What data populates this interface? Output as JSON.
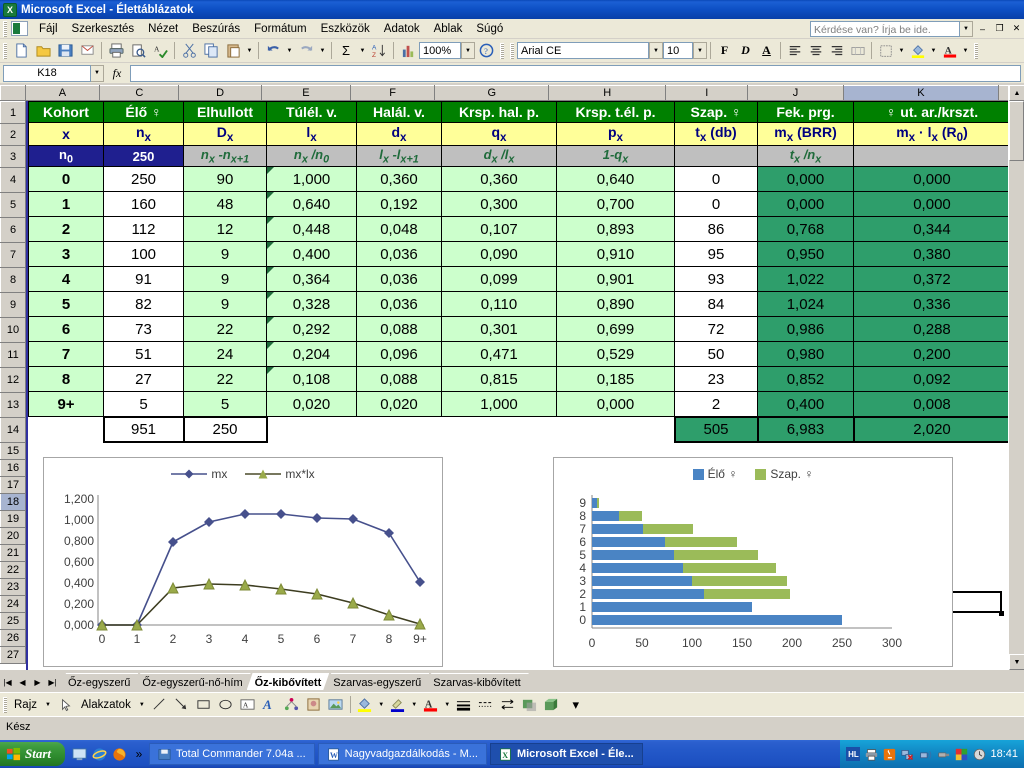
{
  "window": {
    "title": "Microsoft Excel - Élettáblázatok",
    "logo_icon": "excel-icon",
    "minimize": "–",
    "restore": "❐",
    "close": "✕"
  },
  "menu": {
    "items": [
      "Fájl",
      "Szerkesztés",
      "Nézet",
      "Beszúrás",
      "Formátum",
      "Eszközök",
      "Adatok",
      "Ablak",
      "Súgó"
    ],
    "help_placeholder": "Kérdése van? Írja be ide."
  },
  "toolbar": {
    "zoom": "100%",
    "font_name": "Arial CE",
    "font_size": "10",
    "bold": "F",
    "italic": "D",
    "underline": "A"
  },
  "formula_bar": {
    "name_box": "K18",
    "fx": "fx",
    "value": ""
  },
  "grid": {
    "columns": [
      "A",
      "C",
      "D",
      "E",
      "F",
      "G",
      "H",
      "I",
      "J",
      "K"
    ],
    "selected_column": "K",
    "selected_row": "18",
    "row_numbers": [
      "1",
      "2",
      "3",
      "4",
      "5",
      "6",
      "7",
      "8",
      "9",
      "10",
      "11",
      "12",
      "13",
      "14",
      "15",
      "16",
      "17",
      "18",
      "19",
      "20",
      "21",
      "22",
      "23",
      "24",
      "25",
      "26",
      "27"
    ],
    "header_row1": [
      "Kohort",
      "Élő ♀",
      "Elhullott",
      "Túlél. v.",
      "Halál. v.",
      "Krsp. hal. p.",
      "Krsp. t.él. p.",
      "Szap. ♀",
      "Fek. prg.",
      "♀ ut. ar./krszt."
    ],
    "header_row2": [
      "x",
      "n_x",
      "D_x",
      "l_x",
      "d_x",
      "q_x",
      "p_x",
      "t_x (db)",
      "m_x (BRR)",
      "m_x · l_x (R_0)"
    ],
    "header_row3": [
      "n_0",
      "250",
      "n_x -n_x+1",
      "n_x /n_0",
      "l_x -l_x+1",
      "d_x /l_x",
      "1-q_x",
      "",
      "t_x /n_x",
      ""
    ],
    "data_rows": [
      {
        "row": "4",
        "kohort": "0",
        "elo": "250",
        "elhullott": "90",
        "tulel": "1,000",
        "halal": "0,360",
        "q": "0,360",
        "p": "0,640",
        "szap": "0",
        "fek": "0,000",
        "ut": "0,000"
      },
      {
        "row": "5",
        "kohort": "1",
        "elo": "160",
        "elhullott": "48",
        "tulel": "0,640",
        "halal": "0,192",
        "q": "0,300",
        "p": "0,700",
        "szap": "0",
        "fek": "0,000",
        "ut": "0,000"
      },
      {
        "row": "6",
        "kohort": "2",
        "elo": "112",
        "elhullott": "12",
        "tulel": "0,448",
        "halal": "0,048",
        "q": "0,107",
        "p": "0,893",
        "szap": "86",
        "fek": "0,768",
        "ut": "0,344"
      },
      {
        "row": "7",
        "kohort": "3",
        "elo": "100",
        "elhullott": "9",
        "tulel": "0,400",
        "halal": "0,036",
        "q": "0,090",
        "p": "0,910",
        "szap": "95",
        "fek": "0,950",
        "ut": "0,380"
      },
      {
        "row": "8",
        "kohort": "4",
        "elo": "91",
        "elhullott": "9",
        "tulel": "0,364",
        "halal": "0,036",
        "q": "0,099",
        "p": "0,901",
        "szap": "93",
        "fek": "1,022",
        "ut": "0,372"
      },
      {
        "row": "9",
        "kohort": "5",
        "elo": "82",
        "elhullott": "9",
        "tulel": "0,328",
        "halal": "0,036",
        "q": "0,110",
        "p": "0,890",
        "szap": "84",
        "fek": "1,024",
        "ut": "0,336"
      },
      {
        "row": "10",
        "kohort": "6",
        "elo": "73",
        "elhullott": "22",
        "tulel": "0,292",
        "halal": "0,088",
        "q": "0,301",
        "p": "0,699",
        "szap": "72",
        "fek": "0,986",
        "ut": "0,288"
      },
      {
        "row": "11",
        "kohort": "7",
        "elo": "51",
        "elhullott": "24",
        "tulel": "0,204",
        "halal": "0,096",
        "q": "0,471",
        "p": "0,529",
        "szap": "50",
        "fek": "0,980",
        "ut": "0,200"
      },
      {
        "row": "12",
        "kohort": "8",
        "elo": "27",
        "elhullott": "22",
        "tulel": "0,108",
        "halal": "0,088",
        "q": "0,815",
        "p": "0,185",
        "szap": "23",
        "fek": "0,852",
        "ut": "0,092"
      },
      {
        "row": "13",
        "kohort": "9+",
        "elo": "5",
        "elhullott": "5",
        "tulel": "0,020",
        "halal": "0,020",
        "q": "1,000",
        "p": "0,000",
        "szap": "2",
        "fek": "0,400",
        "ut": "0,008"
      }
    ],
    "sum_row": {
      "row": "14",
      "elo": "951",
      "elhullott": "250",
      "szap": "505",
      "fek": "6,983",
      "ut": "2,020"
    }
  },
  "chart_data": [
    {
      "type": "line",
      "title": "",
      "categories": [
        "0",
        "1",
        "2",
        "3",
        "4",
        "5",
        "6",
        "7",
        "8",
        "9+"
      ],
      "series": [
        {
          "name": "mx",
          "values": [
            0.0,
            0.0,
            0.768,
            0.95,
            1.022,
            1.024,
            0.986,
            0.98,
            0.852,
            0.4
          ],
          "color": "#46508c"
        },
        {
          "name": "mx*lx",
          "values": [
            0.0,
            0.0,
            0.344,
            0.38,
            0.372,
            0.336,
            0.288,
            0.2,
            0.092,
            0.008
          ],
          "color": "#9aaa4a"
        }
      ],
      "ytick_labels": [
        "0,000",
        "0,200",
        "0,400",
        "0,600",
        "0,800",
        "1,000",
        "1,200"
      ],
      "ylim": [
        0,
        1.2
      ],
      "xlabel": "",
      "ylabel": "",
      "legend_position": "top",
      "grid": false
    },
    {
      "type": "bar",
      "orientation": "horizontal",
      "stacked": true,
      "title": "",
      "categories": [
        "0",
        "1",
        "2",
        "3",
        "4",
        "5",
        "6",
        "7",
        "8",
        "9"
      ],
      "series": [
        {
          "name": "Élő ♀",
          "values": [
            250,
            160,
            112,
            100,
            91,
            82,
            73,
            51,
            27,
            5
          ],
          "color": "#4a84c4"
        },
        {
          "name": "Szap. ♀",
          "values": [
            0,
            0,
            86,
            95,
            93,
            84,
            72,
            50,
            23,
            2
          ],
          "color": "#9bbb59"
        }
      ],
      "xtick_labels": [
        "0",
        "50",
        "100",
        "150",
        "200",
        "250",
        "300"
      ],
      "xlim": [
        0,
        300
      ],
      "xlabel": "",
      "ylabel": "",
      "legend_position": "top",
      "grid": false
    }
  ],
  "sheet_tabs": {
    "items": [
      "Őz-egyszerű",
      "Őz-egyszerű-nő-hím",
      "Őz-kibővített",
      "Szarvas-egyszerű",
      "Szarvas-kibővített"
    ],
    "active": "Őz-kibővített",
    "nav_first": "|◀",
    "nav_prev": "◀",
    "nav_next": "▶",
    "nav_last": "▶|"
  },
  "drawing_toolbar": {
    "menu_label": "Rajz",
    "shapes_label": "Alakzatok"
  },
  "status_bar": {
    "text": "Kész"
  },
  "taskbar": {
    "start": "Start",
    "quick_launch": [
      "show-desktop-icon",
      "internet-explorer-icon",
      "firefox-icon"
    ],
    "overflow": "»",
    "tasks": [
      {
        "label": "Total Commander 7.04a ...",
        "icon": "totalcmd-icon",
        "active": false
      },
      {
        "label": "Nagyvadgazdálkodás - M...",
        "icon": "word-icon",
        "active": false
      },
      {
        "label": "Microsoft Excel - Éle...",
        "icon": "excel-icon",
        "active": true
      }
    ],
    "tray_icons": [
      "hl-icon",
      "printer-icon",
      "java-icon",
      "network-error-icon",
      "wireless-icon",
      "usb-icon",
      "colors-icon",
      "clock-icon"
    ],
    "clock": "18:41"
  },
  "colors": {
    "header_green": "#008000",
    "header_yellow": "#ffff99",
    "formula_gray": "#bfbfbf",
    "navy": "#1f1f8f",
    "light_green": "#ccffcc",
    "dark_green": "#2e9e6b",
    "titlebar_blue": "#0d4fc4"
  }
}
